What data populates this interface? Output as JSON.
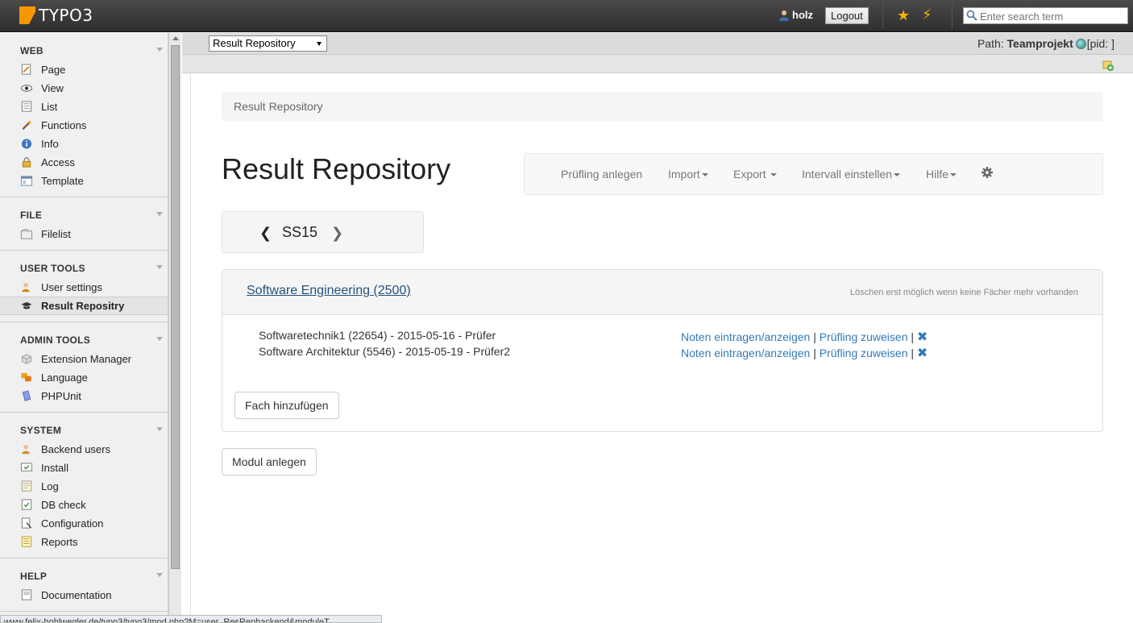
{
  "topbar": {
    "logo_text": "TYPO3",
    "username": "holz",
    "logout_label": "Logout",
    "search_placeholder": "Enter search term",
    "icons": [
      "user-icon",
      "star-icon",
      "lightning-icon",
      "search-icon"
    ]
  },
  "sidebar": {
    "groups": [
      {
        "title": "WEB",
        "items": [
          {
            "label": "Page",
            "icon": "page-icon"
          },
          {
            "label": "View",
            "icon": "eye-icon"
          },
          {
            "label": "List",
            "icon": "list-icon"
          },
          {
            "label": "Functions",
            "icon": "wand-icon"
          },
          {
            "label": "Info",
            "icon": "info-icon"
          },
          {
            "label": "Access",
            "icon": "lock-icon"
          },
          {
            "label": "Template",
            "icon": "template-icon"
          }
        ]
      },
      {
        "title": "FILE",
        "items": [
          {
            "label": "Filelist",
            "icon": "filelist-icon"
          }
        ]
      },
      {
        "title": "USER TOOLS",
        "items": [
          {
            "label": "User settings",
            "icon": "user-settings-icon"
          },
          {
            "label": "Result Repositry",
            "icon": "graduation-cap-icon",
            "active": true
          }
        ]
      },
      {
        "title": "ADMIN TOOLS",
        "items": [
          {
            "label": "Extension Manager",
            "icon": "extension-icon"
          },
          {
            "label": "Language",
            "icon": "language-icon"
          },
          {
            "label": "PHPUnit",
            "icon": "phpunit-icon"
          }
        ]
      },
      {
        "title": "SYSTEM",
        "items": [
          {
            "label": "Backend users",
            "icon": "backend-users-icon"
          },
          {
            "label": "Install",
            "icon": "install-icon"
          },
          {
            "label": "Log",
            "icon": "log-icon"
          },
          {
            "label": "DB check",
            "icon": "db-check-icon"
          },
          {
            "label": "Configuration",
            "icon": "configuration-icon"
          },
          {
            "label": "Reports",
            "icon": "reports-icon"
          }
        ]
      },
      {
        "title": "HELP",
        "items": [
          {
            "label": "Documentation",
            "icon": "documentation-icon"
          }
        ]
      }
    ]
  },
  "docheader": {
    "module_select": "Result Repository",
    "path_label": "Path:",
    "path_value": "Teamprojekt",
    "path_pid": "[pid: ]"
  },
  "main": {
    "breadcrumb": "Result Repository",
    "title": "Result Repository",
    "nav": {
      "create_examinee": "Prüfling anlegen",
      "import": "Import",
      "export": "Export",
      "interval": "Intervall einstellen",
      "help": "Hilfe"
    },
    "semester": "SS15",
    "module": {
      "title": "Software Engineering (2500)",
      "delete_note": "Löschen erst möglich wenn keine Fächer mehr vorhanden",
      "exams": [
        {
          "text": "Softwaretechnik1 (22654) - 2015-05-16 - Prüfer",
          "grades_link": "Noten eintragen/anzeigen",
          "assign_link": "Prüfling zuweisen",
          "sep": "|",
          "delete": "✖"
        },
        {
          "text": "Software Architektur (5546) - 2015-05-19 - Prüfer2",
          "grades_link": "Noten eintragen/anzeigen",
          "assign_link": "Prüfling zuweisen",
          "sep": "|",
          "delete": "✖"
        }
      ],
      "add_subject_label": "Fach hinzufügen"
    },
    "create_module_label": "Modul anlegen"
  },
  "statusbar": {
    "url": "www.felix-hohlwegler.de/typo3/typo3/mod.php?M=user_ResRepbackend&moduleT..."
  },
  "colors": {
    "accent": "#f49700",
    "link": "#337ab7"
  }
}
